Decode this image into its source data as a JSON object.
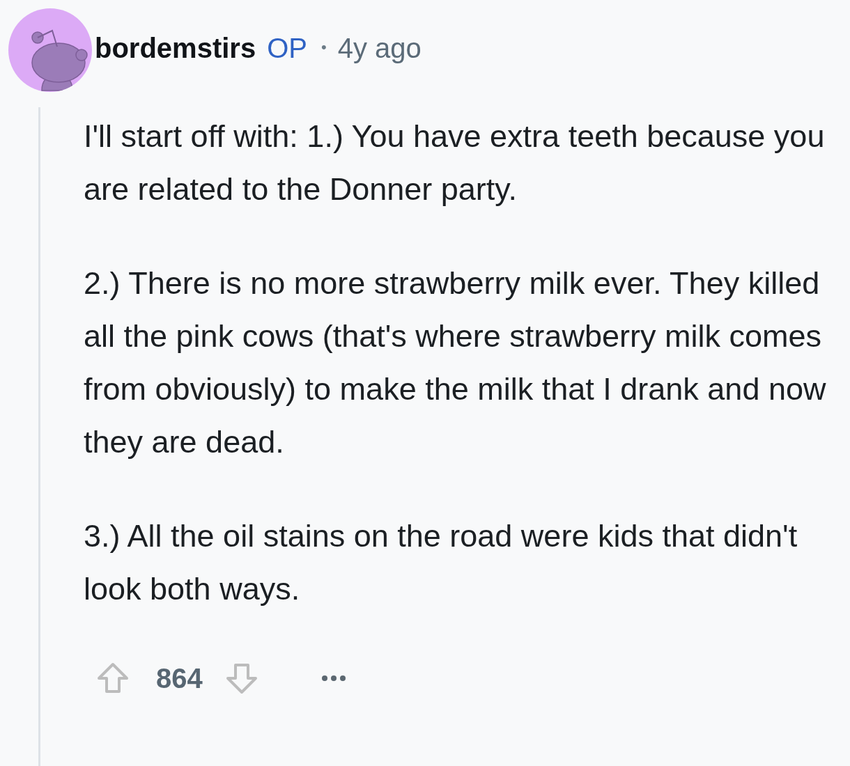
{
  "comment": {
    "author": "bordemstirs",
    "badge": "OP",
    "separator": "•",
    "time": "4y ago",
    "paragraphs": [
      "I'll start off with: 1.) You have extra teeth because you are related to the Donner party.",
      "2.) There is no more strawberry milk ever. They killed all the pink cows (that's where strawberry milk comes from obviously) to make the milk that I drank and now they are dead.",
      "3.) All the oil stains on the road were kids that didn't look both ways."
    ],
    "score": "864"
  }
}
